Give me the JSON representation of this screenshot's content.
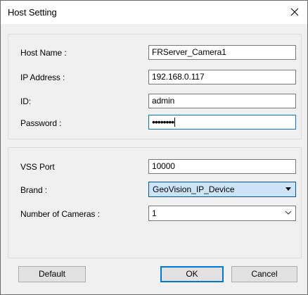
{
  "window": {
    "title": "Host Setting"
  },
  "host_group": {
    "host_name": {
      "label": "Host Name :",
      "value": "FRServer_Camera1"
    },
    "ip_address": {
      "label": "IP Address :",
      "value": "192.168.0.117"
    },
    "id": {
      "label": "ID:",
      "value": "admin"
    },
    "password": {
      "label": "Password :",
      "value": "••••••••"
    }
  },
  "device_group": {
    "vss_port": {
      "label": "VSS Port",
      "value": "10000"
    },
    "brand": {
      "label": "Brand :",
      "value": "GeoVision_IP_Device"
    },
    "cameras": {
      "label": "Number of Cameras :",
      "value": "1"
    }
  },
  "buttons": {
    "default": "Default",
    "ok": "OK",
    "cancel": "Cancel"
  },
  "icons": {
    "close": "close-icon",
    "brand_dropdown": "dropdown-arrow-icon",
    "cameras_dropdown": "chevron-down-icon"
  },
  "colors": {
    "focus_border": "#0078d7",
    "selected_combo_bg": "#cce4f7"
  }
}
